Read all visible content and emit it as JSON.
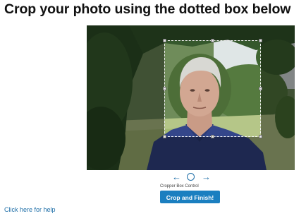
{
  "header": {
    "title": "Crop your photo using the dotted box below"
  },
  "cropper": {
    "control_label": "Cropper Box Control",
    "left_arrow": "←",
    "right_arrow": "→"
  },
  "actions": {
    "crop_button_label": "Crop and Finish!"
  },
  "footer": {
    "help_link": "Click here for help"
  },
  "colors": {
    "accent": "#1b7fc0",
    "link": "#1f6fa8"
  }
}
